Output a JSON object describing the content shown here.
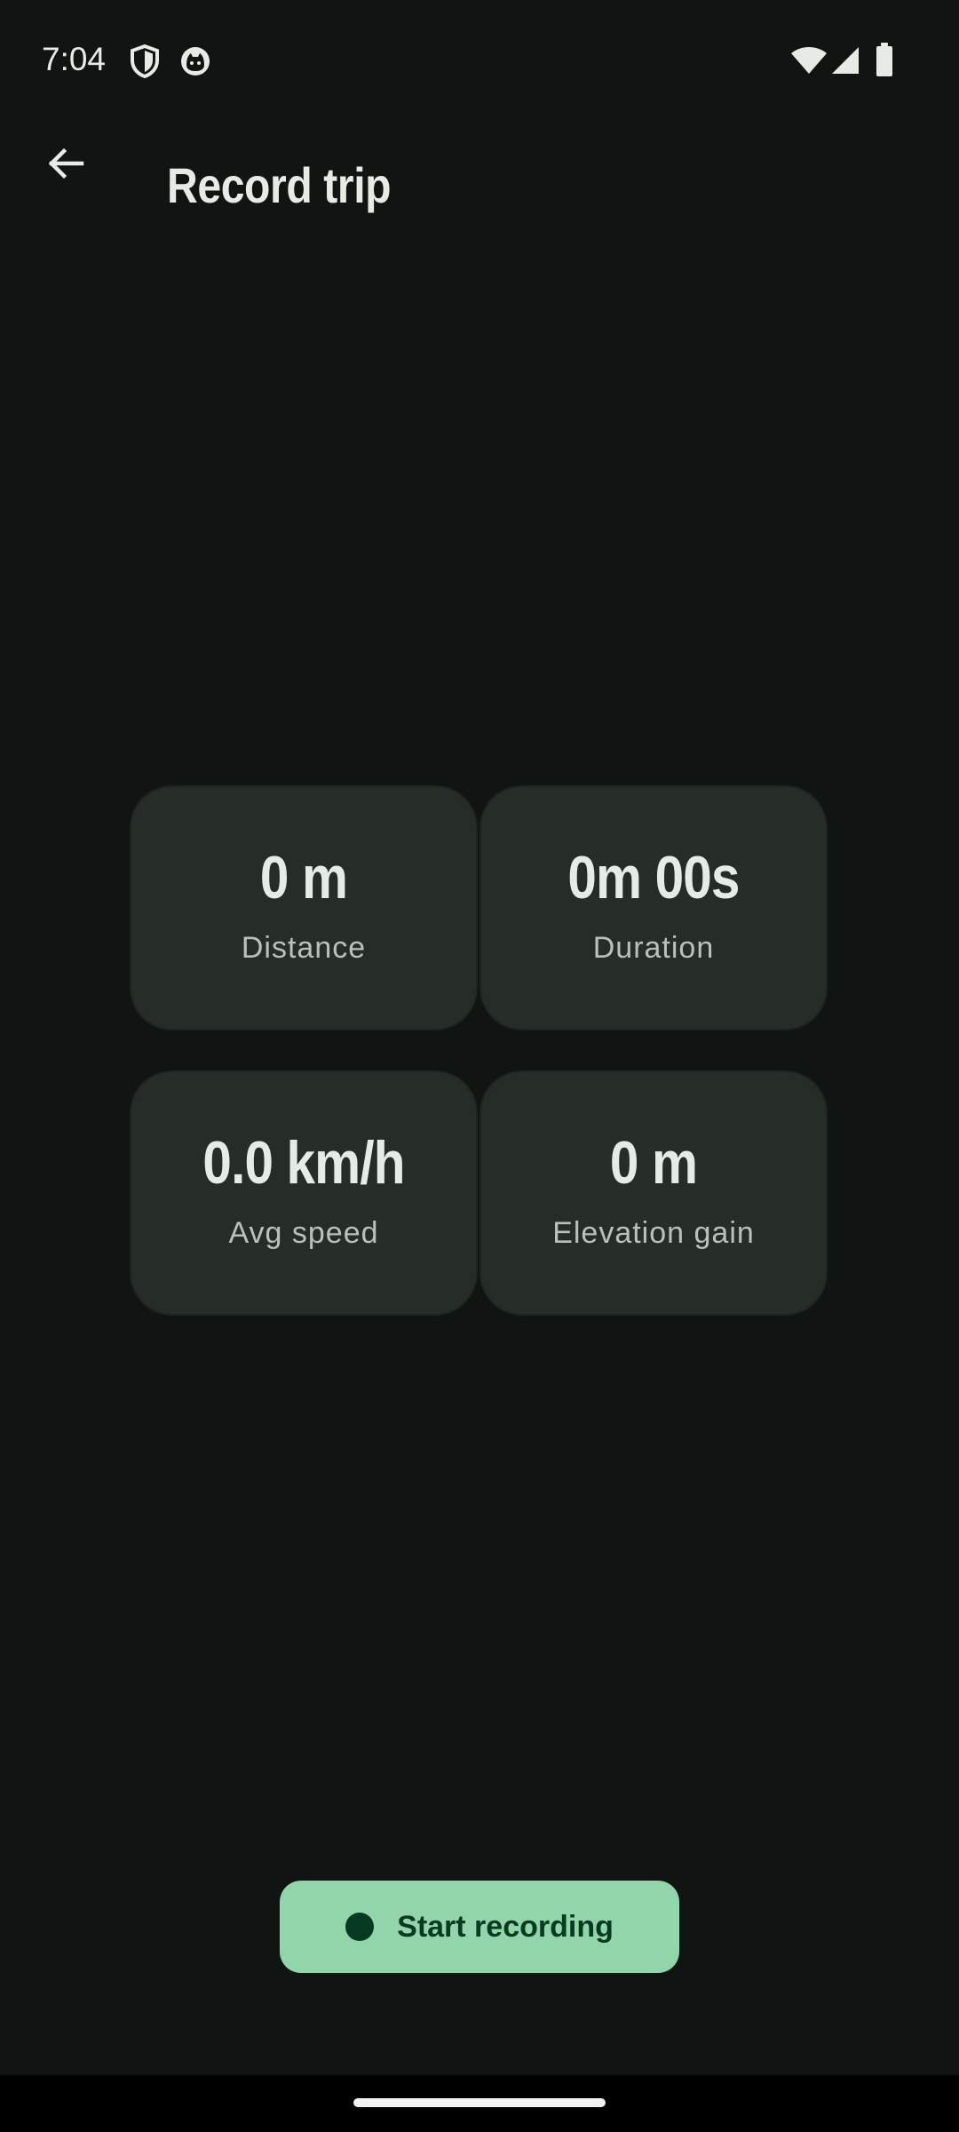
{
  "status_bar": {
    "time": "7:04",
    "left_icons": [
      "vpn-shield-icon",
      "cat-face-icon"
    ],
    "right_icons": [
      "wifi-icon",
      "cellular-signal-icon",
      "battery-icon"
    ]
  },
  "app_bar": {
    "back_icon": "arrow-back-icon",
    "title": "Record trip"
  },
  "stats": [
    {
      "value": "0 m",
      "label": "Distance"
    },
    {
      "value": "0m 00s",
      "label": "Duration"
    },
    {
      "value": "0.0 km/h",
      "label": "Avg speed"
    },
    {
      "value": "0 m",
      "label": "Elevation gain"
    }
  ],
  "start_button": {
    "icon": "record-dot-icon",
    "label": "Start recording"
  },
  "colors": {
    "background": "#101413",
    "card": "#262c28",
    "accent": "#93d5ab",
    "accent_on": "#063a21",
    "text_primary": "#e6ebe5",
    "text_secondary": "#b9c1ba"
  }
}
